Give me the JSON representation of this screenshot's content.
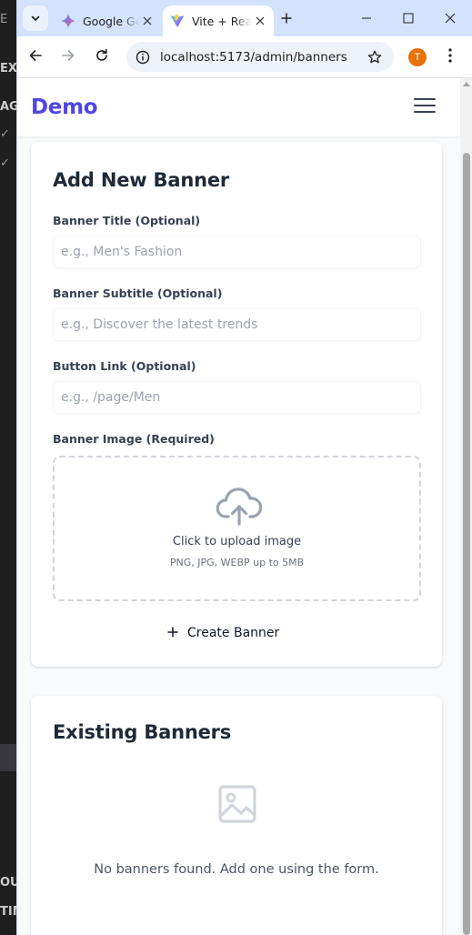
{
  "background_app": {
    "fragments": [
      "E",
      "EXP",
      "AG",
      "✓",
      "✓",
      "OU",
      "TIM"
    ]
  },
  "browser": {
    "tabs": [
      {
        "title": "Google Gemini",
        "icon": "gemini-icon",
        "active": false
      },
      {
        "title": "Vite + React",
        "icon": "vite-icon",
        "active": true
      }
    ],
    "url": "localhost:5173/admin/banners",
    "profile_initial": "T"
  },
  "app": {
    "brand": "Demo",
    "menu_icon": "hamburger-menu-icon"
  },
  "form": {
    "heading": "Add New Banner",
    "title_label": "Banner Title (Optional)",
    "title_placeholder": "e.g., Men's Fashion",
    "subtitle_label": "Banner Subtitle (Optional)",
    "subtitle_placeholder": "e.g., Discover the latest trends",
    "link_label": "Button Link (Optional)",
    "link_placeholder": "e.g., /page/Men",
    "image_label": "Banner Image (Required)",
    "upload_title": "Click to upload image",
    "upload_hint": "PNG, JPG, WEBP up to 5MB",
    "submit_label": "Create Banner"
  },
  "existing": {
    "heading": "Existing Banners",
    "empty_message": "No banners found. Add one using the form."
  },
  "colors": {
    "brand": "#4f46e5",
    "tabstrip": "#d3e3fd",
    "page_bg": "#f9fafb"
  }
}
